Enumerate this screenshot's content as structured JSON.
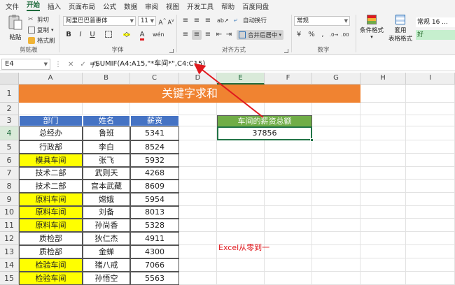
{
  "menu": {
    "tabs": [
      "文件",
      "开始",
      "插入",
      "页面布局",
      "公式",
      "数据",
      "审阅",
      "视图",
      "开发工具",
      "帮助",
      "百度网盘"
    ],
    "active": "开始"
  },
  "ribbon": {
    "clipboard": {
      "paste": "粘贴",
      "cut": "剪切",
      "copy": "复制",
      "format_painter": "格式刷",
      "label": "剪贴板"
    },
    "font": {
      "name": "阿里巴巴普惠体",
      "size": "11",
      "label": "字体"
    },
    "align": {
      "wrap": "自动换行",
      "merge": "合并后居中",
      "label": "对齐方式"
    },
    "number": {
      "format": "常规",
      "label": "数字"
    },
    "styles": {
      "cond": "条件格式",
      "table": "套用",
      "table2": "表格格式",
      "normal": "常规 16 ...",
      "good": "好"
    }
  },
  "formula_bar": {
    "namebox": "E4",
    "formula": "=SUMIF(A4:A15,\"*车间*\",C4:C15)"
  },
  "columns": [
    "A",
    "B",
    "C",
    "D",
    "E",
    "F",
    "G",
    "H",
    "I"
  ],
  "rows": [
    "1",
    "2",
    "3",
    "4",
    "5",
    "6",
    "7",
    "8",
    "9",
    "10",
    "11",
    "12",
    "13",
    "14",
    "15",
    "16"
  ],
  "sheet": {
    "title": "关键字求和",
    "headers": [
      "部门",
      "姓名",
      "薪资"
    ],
    "data": [
      [
        "总经办",
        "鲁班",
        "5341"
      ],
      [
        "行政部",
        "李白",
        "8524"
      ],
      [
        "模具车间",
        "张飞",
        "5932"
      ],
      [
        "技术二部",
        "武则天",
        "4268"
      ],
      [
        "技术二部",
        "宫本武藏",
        "8609"
      ],
      [
        "原料车间",
        "嫦娥",
        "5954"
      ],
      [
        "原料车间",
        "刘备",
        "8013"
      ],
      [
        "原料车间",
        "孙尚香",
        "5328"
      ],
      [
        "质检部",
        "狄仁杰",
        "4911"
      ],
      [
        "质检部",
        "金蝉",
        "4300"
      ],
      [
        "检验车间",
        "猪八戒",
        "7066"
      ],
      [
        "检验车间",
        "孙悟空",
        "5563"
      ]
    ],
    "highlighted_rows": [
      2,
      5,
      6,
      7,
      10,
      11
    ],
    "sum_header": "车间的薪资总额",
    "sum_value": "37856",
    "watermark": "Excel从零到一"
  },
  "colors": {
    "title": "#f08331",
    "header": "#4573c4",
    "sum_header": "#70ad47",
    "highlight": "#ffff00",
    "arrow": "#e0191e",
    "accent": "#217346"
  }
}
